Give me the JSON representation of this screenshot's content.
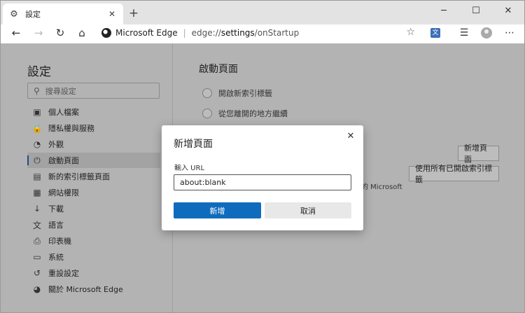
{
  "tab": {
    "title": "設定",
    "icon": "gear-icon"
  },
  "window_controls": {
    "minimize": "─",
    "maximize": "☐",
    "close": "✕"
  },
  "address_bar": {
    "site_name": "Microsoft Edge",
    "url_prefix": "edge://",
    "url_path": "settings",
    "url_suffix": "/onStartup"
  },
  "sidebar": {
    "title": "設定",
    "search_placeholder": "搜尋設定",
    "items": [
      {
        "label": "個人檔案",
        "icon": "profile-icon",
        "glyph": "▣"
      },
      {
        "label": "隱私權與服務",
        "icon": "lock-icon",
        "glyph": "🔒"
      },
      {
        "label": "外觀",
        "icon": "palette-icon",
        "glyph": "◔"
      },
      {
        "label": "啟動頁面",
        "icon": "power-icon",
        "glyph": "⏻"
      },
      {
        "label": "新的索引標籤頁面",
        "icon": "newtab-icon",
        "glyph": "▤"
      },
      {
        "label": "網站權限",
        "icon": "site-permissions-icon",
        "glyph": "▦"
      },
      {
        "label": "下載",
        "icon": "download-icon",
        "glyph": "↓"
      },
      {
        "label": "語言",
        "icon": "language-icon",
        "glyph": "文"
      },
      {
        "label": "印表機",
        "icon": "printer-icon",
        "glyph": "⎙"
      },
      {
        "label": "系統",
        "icon": "system-icon",
        "glyph": "▭"
      },
      {
        "label": "重設設定",
        "icon": "reset-icon",
        "glyph": "↺"
      },
      {
        "label": "關於 Microsoft Edge",
        "icon": "edge-logo-icon",
        "glyph": "◕"
      }
    ],
    "active_index": 3
  },
  "main": {
    "title": "啟動頁面",
    "options": [
      "開啟新索引標籤",
      "從您離開的地方繼續"
    ],
    "add_page_button": "新增頁面",
    "use_all_tabs_button": "使用所有已開啟索引標籤",
    "partial_text": "的 Microsoft"
  },
  "dialog": {
    "title": "新增頁面",
    "label": "輸入 URL",
    "input_value": "about:blank",
    "add_button": "新增",
    "cancel_button": "取消"
  }
}
